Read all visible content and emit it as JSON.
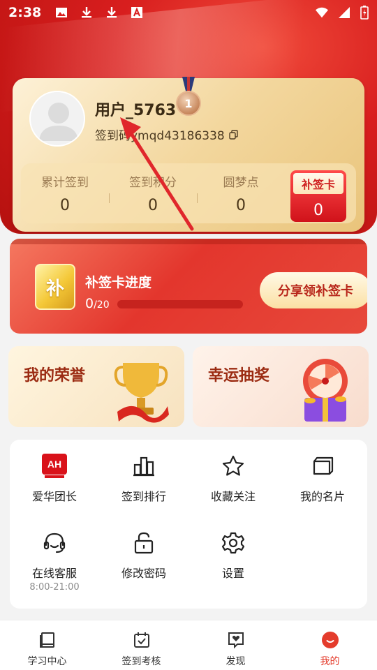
{
  "status_bar": {
    "time": "2:38"
  },
  "profile": {
    "username": "用户_5763",
    "medal_rank": "1",
    "signin_id": "签到码ymqd43186338"
  },
  "stats": [
    {
      "label": "累计签到",
      "value": "0"
    },
    {
      "label": "签到积分",
      "value": "0"
    },
    {
      "label": "圆梦点",
      "value": "0"
    }
  ],
  "makeup_card": {
    "label": "补签卡",
    "value": "0"
  },
  "progress": {
    "badge": "补",
    "title": "补签卡进度",
    "current": "0",
    "total": "/20",
    "fraction": 0,
    "share_label": "分享领补签卡"
  },
  "tiles": {
    "honor": "我的荣誉",
    "lottery": "幸运抽奖"
  },
  "menu": [
    {
      "label": "爱华团长",
      "icon": "aihua-logo-icon"
    },
    {
      "label": "签到排行",
      "icon": "ranking-icon"
    },
    {
      "label": "收藏关注",
      "icon": "star-icon"
    },
    {
      "label": "我的名片",
      "icon": "card-folder-icon"
    },
    {
      "label": "在线客服",
      "sub": "8:00-21:00",
      "icon": "headset-icon"
    },
    {
      "label": "修改密码",
      "icon": "unlock-icon"
    },
    {
      "label": "设置",
      "icon": "gear-icon"
    }
  ],
  "nav": [
    {
      "label": "学习中心"
    },
    {
      "label": "签到考核"
    },
    {
      "label": "发现"
    },
    {
      "label": "我的"
    }
  ],
  "colors": {
    "accent": "#e43c2c",
    "brand_red": "#d81e1e",
    "gold": "#f3d79e"
  }
}
